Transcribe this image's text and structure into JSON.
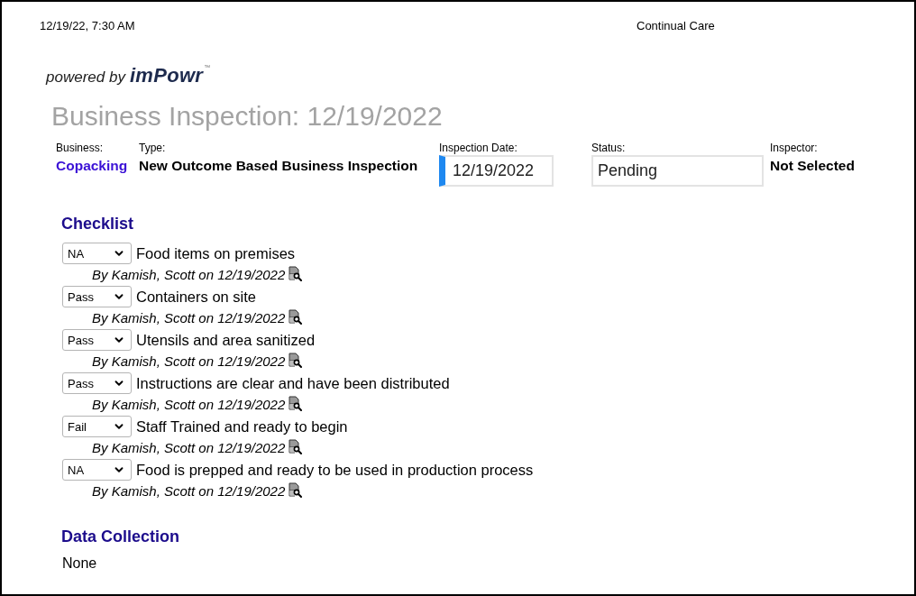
{
  "header": {
    "timestamp": "12/19/22, 7:30 AM",
    "organization": "Continual Care"
  },
  "logo": {
    "tagline": "powered by",
    "brand": "imPowr",
    "mark": "™"
  },
  "title": "Business Inspection: 12/19/2022",
  "fields": [
    {
      "kind": "link",
      "label": "Business:",
      "value": "Copacking"
    },
    {
      "kind": "text",
      "label": "Type:",
      "value": "New Outcome Based Business Inspection"
    },
    {
      "kind": "input",
      "label": "Inspection Date:",
      "value": "12/19/2022",
      "focused": true
    },
    {
      "kind": "input",
      "label": "Status:",
      "value": "Pending",
      "focused": false
    },
    {
      "kind": "text",
      "label": "Inspector:",
      "value": "Not Selected"
    }
  ],
  "checklist": {
    "heading": "Checklist",
    "items": [
      {
        "result": "NA",
        "label": "Food items on premises",
        "note": "By Kamish, Scott on 12/19/2022"
      },
      {
        "result": "Pass",
        "label": "Containers on site",
        "note": "By Kamish, Scott on 12/19/2022"
      },
      {
        "result": "Pass",
        "label": "Utensils and area sanitized",
        "note": "By Kamish, Scott on 12/19/2022"
      },
      {
        "result": "Pass",
        "label": "Instructions are clear and have been distributed",
        "note": "By Kamish, Scott on 12/19/2022"
      },
      {
        "result": "Fail",
        "label": "Staff Trained and ready to begin",
        "note": "By Kamish, Scott on 12/19/2022"
      },
      {
        "result": "NA",
        "label": "Food is prepped and ready to be used in production process",
        "note": "By Kamish, Scott on 12/19/2022"
      }
    ]
  },
  "data_collection": {
    "heading": "Data Collection",
    "value": "None"
  }
}
